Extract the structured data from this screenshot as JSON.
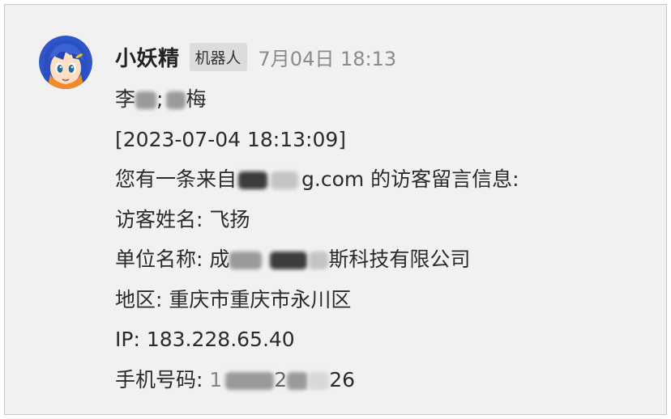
{
  "message": {
    "sender": "小妖精",
    "badge": "机器人",
    "time": "7月04日 18:13",
    "lines": {
      "recipients_a": "李",
      "recipients_b": ";",
      "recipients_c": "梅",
      "datetime": "[2023-07-04 18:13:09]",
      "notice_prefix": "您有一条来自",
      "notice_domain_tail": "g.com",
      "notice_suffix": " 的访客留言信息:",
      "visitor_name": "访客姓名: 飞扬",
      "company_label": "单位名称: ",
      "company_head": "成",
      "company_tail": "斯科技有限公司",
      "region": "地区: 重庆市重庆市永川区",
      "ip": "IP: 183.228.65.40",
      "phone_label": "手机号码: ",
      "phone_head": "1",
      "phone_mid": "2",
      "phone_tail": "26"
    }
  },
  "avatar_icon": "anime-girl-avatar",
  "colors": {
    "card_bg": "#f1f1f2",
    "badge_bg": "#dcdcdc",
    "time_text": "#8b8b8b"
  }
}
